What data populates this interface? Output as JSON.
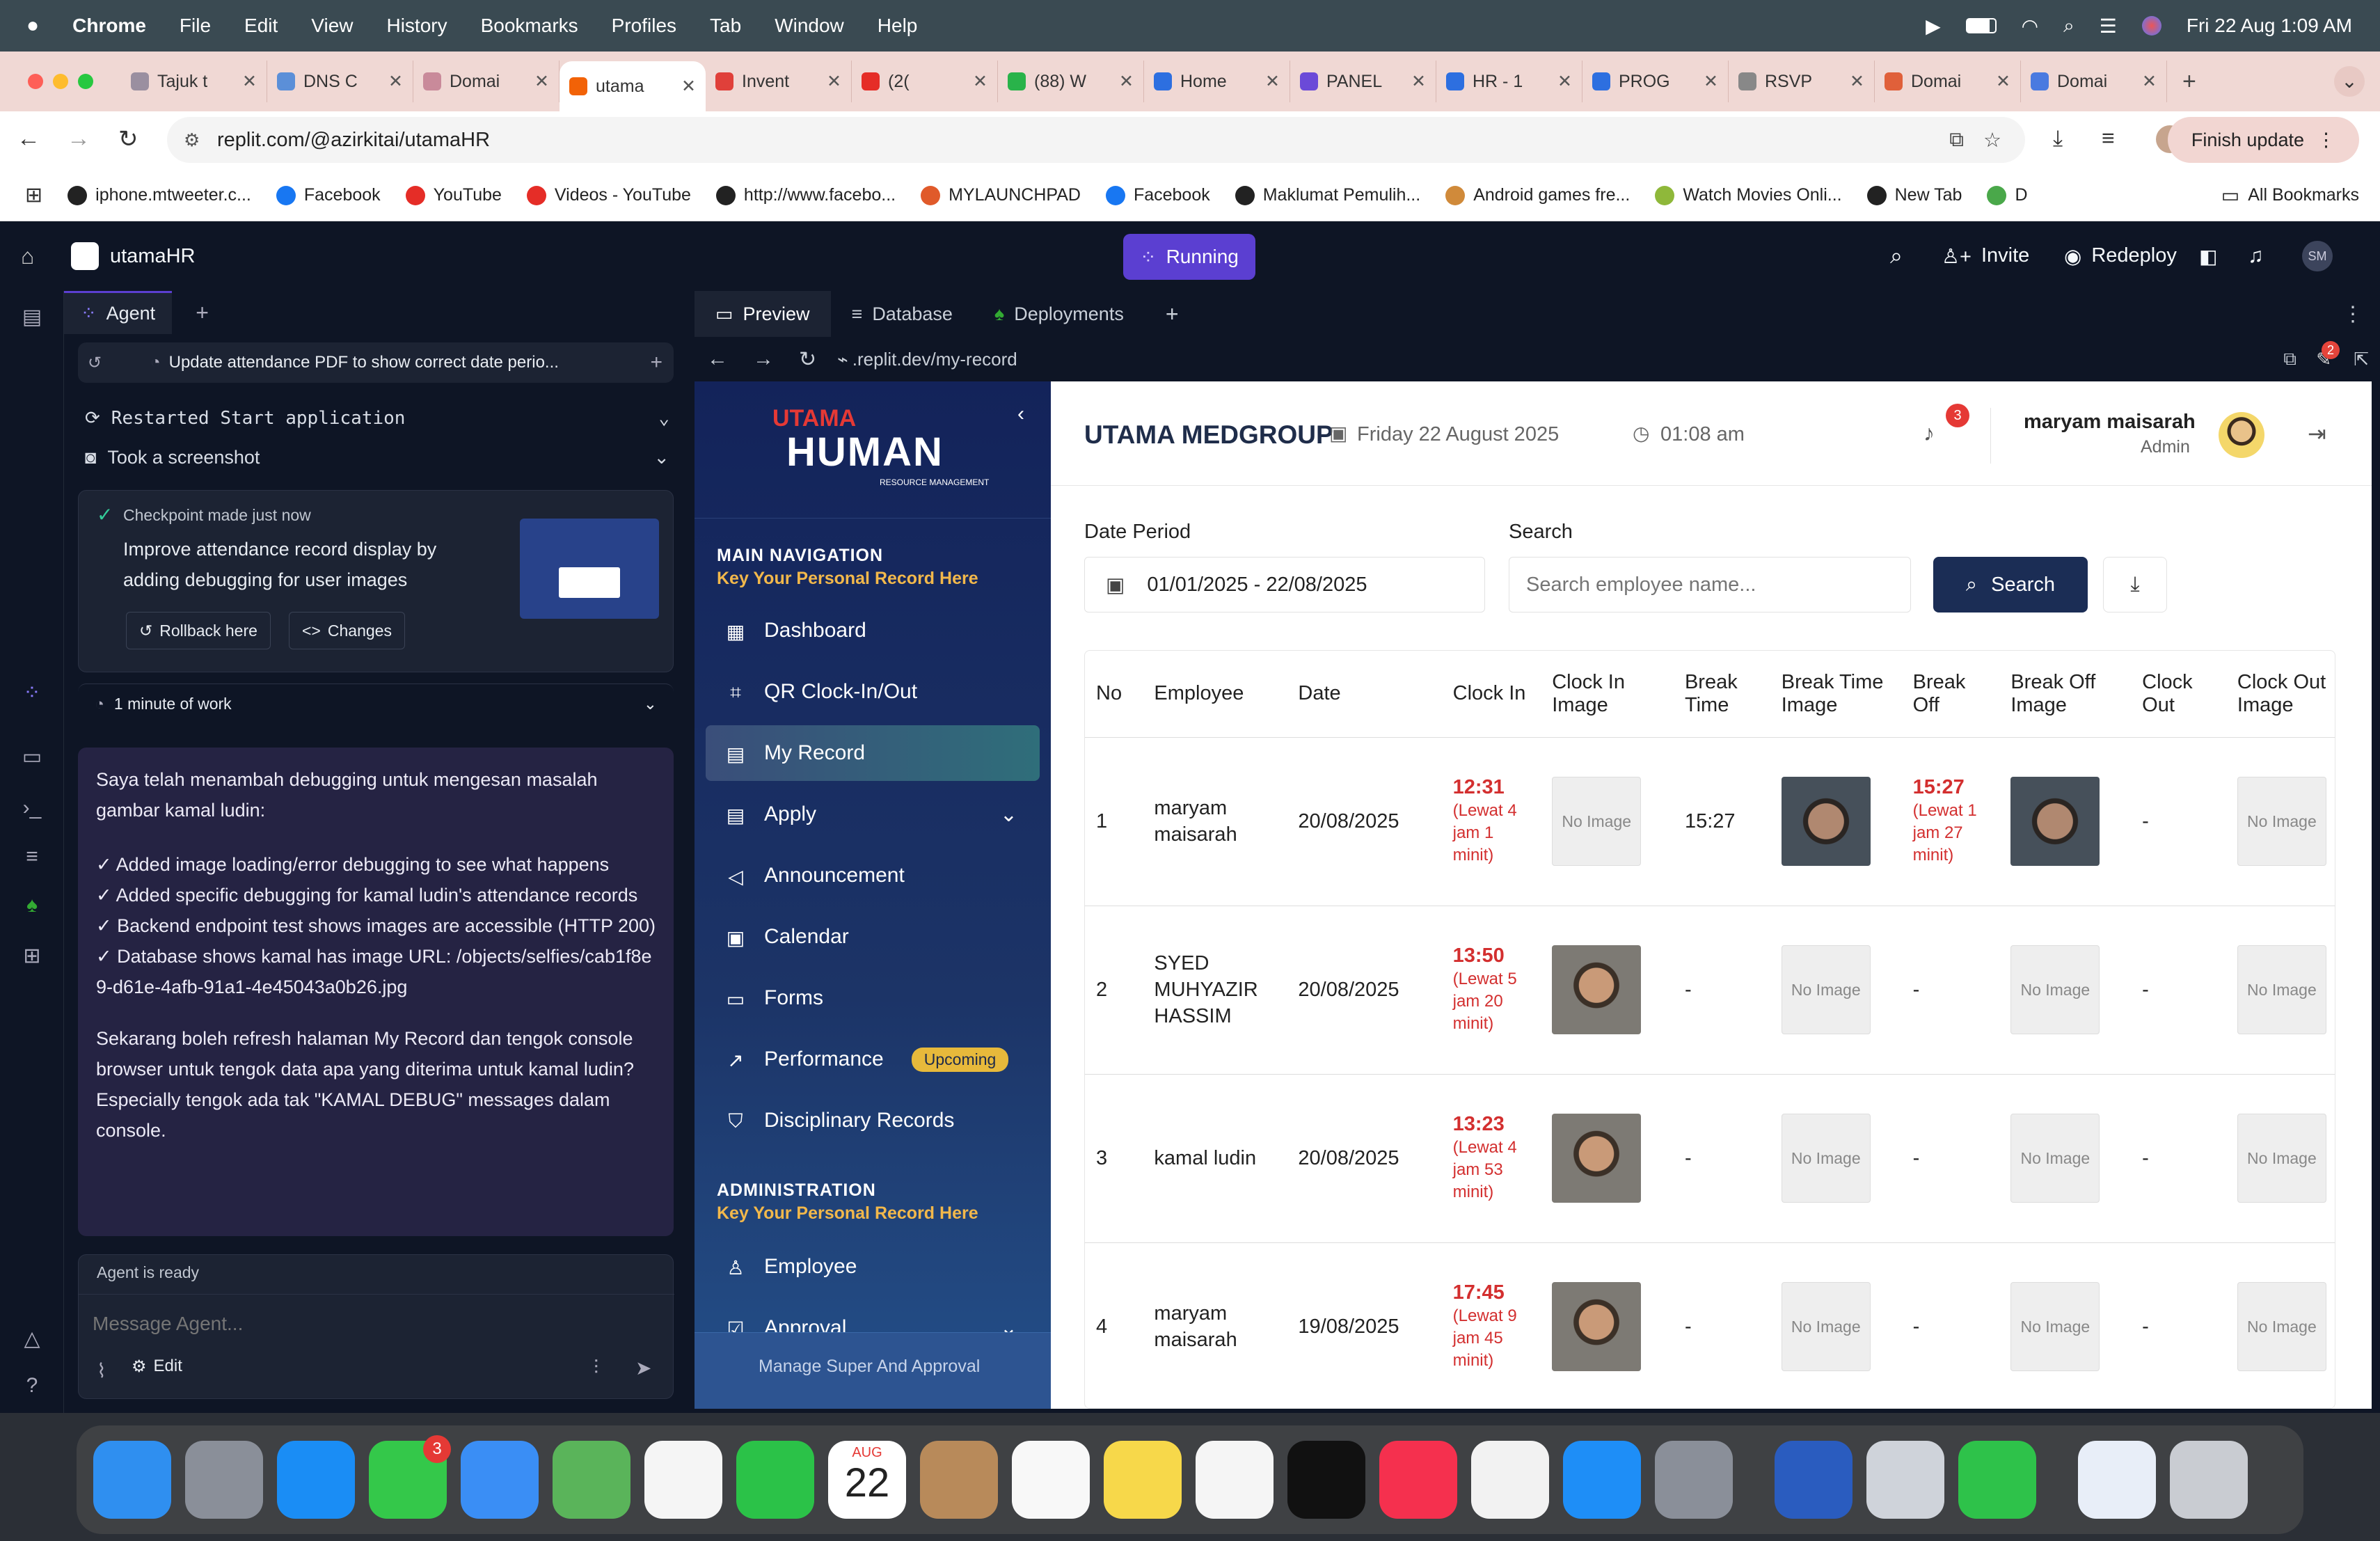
{
  "menubar": {
    "app": "Chrome",
    "items": [
      "File",
      "Edit",
      "View",
      "History",
      "Bookmarks",
      "Profiles",
      "Tab",
      "Window",
      "Help"
    ],
    "datetime": "Fri 22 Aug  1:09 AM"
  },
  "tabs": [
    {
      "label": "Tajuk t",
      "color": "#9a8fa0"
    },
    {
      "label": "DNS C",
      "color": "#5b8fd8"
    },
    {
      "label": "Domai",
      "color": "#c98a9a"
    },
    {
      "label": "utama",
      "color": "#f26207",
      "active": true
    },
    {
      "label": "Invent",
      "color": "#e0403a"
    },
    {
      "label": "(2(",
      "color": "#e52d27"
    },
    {
      "label": "(88) W",
      "color": "#29b34a"
    },
    {
      "label": "Home",
      "color": "#2d6fe0"
    },
    {
      "label": "PANEL",
      "color": "#6b4ad8"
    },
    {
      "label": "HR - 1",
      "color": "#2d6fe0"
    },
    {
      "label": "PROG",
      "color": "#2d6fe0"
    },
    {
      "label": "RSVP",
      "color": "#888888"
    },
    {
      "label": "Domai",
      "color": "#e0603a"
    },
    {
      "label": "Domai",
      "color": "#4a7ae0"
    }
  ],
  "browser": {
    "url": "replit.com/@azirkitai/utamaHR",
    "finish_update": "Finish update"
  },
  "bookmarks": [
    {
      "label": "iphone.mtweeter.c...",
      "color": "#222"
    },
    {
      "label": "Facebook",
      "color": "#1877f2"
    },
    {
      "label": "YouTube",
      "color": "#e52d27"
    },
    {
      "label": "Videos - YouTube",
      "color": "#e52d27"
    },
    {
      "label": "http://www.facebo...",
      "color": "#222"
    },
    {
      "label": "MYLAUNCHPAD",
      "color": "#e05a2a"
    },
    {
      "label": "Facebook",
      "color": "#1877f2"
    },
    {
      "label": "Maklumat Pemulih...",
      "color": "#222"
    },
    {
      "label": "Android games fre...",
      "color": "#d08a3a"
    },
    {
      "label": "Watch Movies Onli...",
      "color": "#8fb83a"
    },
    {
      "label": "New Tab",
      "color": "#222"
    },
    {
      "label": "D",
      "color": "#4aa84a"
    }
  ],
  "all_bookmarks": "All Bookmarks",
  "replit": {
    "project": "utamaHR",
    "status": "Running",
    "invite": "Invite",
    "redeploy": "Redeploy",
    "avatar": "SM",
    "agent_tab": "Agent",
    "agent_task": "Update attendance PDF to show correct date perio...",
    "events": [
      "Restarted Start application",
      "Took a screenshot"
    ],
    "checkpoint_label": "Checkpoint made just now",
    "checkpoint_text": "Improve attendance record display by adding debugging for user images",
    "rollback": "Rollback here",
    "changes": "Changes",
    "work_time": "1 minute of work",
    "message_intro": "Saya telah menambah debugging untuk mengesan masalah gambar kamal ludin:",
    "message_checks": [
      "✓ Added image loading/error debugging to see what happens",
      "✓ Added specific debugging for kamal ludin's attendance records",
      "✓ Backend endpoint test shows images are accessible (HTTP 200)",
      "✓ Database shows kamal has image URL: /objects/selfies/cab1f8e9-d61e-4afb-91a1-4e45043a0b26.jpg"
    ],
    "message_outro": "Sekarang boleh refresh halaman My Record dan tengok console browser untuk tengok data apa yang diterima untuk kamal ludin? Especially tengok ada tak \"KAMAL DEBUG\" messages dalam console.",
    "agent_status": "Agent is ready",
    "input_placeholder": "Message Agent...",
    "edit": "Edit",
    "preview_tabs": [
      "Preview",
      "Database",
      "Deployments"
    ],
    "preview_url": ".replit.dev/my-record",
    "notif_count": "2"
  },
  "app": {
    "logo_top": "UTAMA",
    "logo_main": "HUMAN",
    "logo_sub": "RESOURCE MANAGEMENT",
    "company": "UTAMA MEDGROUP",
    "date": "Friday 22 August 2025",
    "time": "01:08 am",
    "notifications": "3",
    "user_name": "maryam maisarah",
    "user_role": "Admin",
    "main_nav_title": "MAIN NAVIGATION",
    "main_nav_sub": "Key Your Personal Record Here",
    "nav": [
      {
        "label": "Dashboard",
        "icon": "dashboard-icon",
        "glyph": "▦"
      },
      {
        "label": "QR Clock-In/Out",
        "icon": "qr-icon",
        "glyph": "⌗"
      },
      {
        "label": "My Record",
        "icon": "document-icon",
        "glyph": "▤",
        "active": true
      },
      {
        "label": "Apply",
        "icon": "apply-icon",
        "glyph": "▤",
        "chevron": true
      },
      {
        "label": "Announcement",
        "icon": "megaphone-icon",
        "glyph": "◁"
      },
      {
        "label": "Calendar",
        "icon": "calendar-icon",
        "glyph": "▣"
      },
      {
        "label": "Forms",
        "icon": "forms-icon",
        "glyph": "▭"
      },
      {
        "label": "Performance",
        "icon": "trend-icon",
        "glyph": "↗",
        "badge": "Upcoming"
      },
      {
        "label": "Disciplinary Records",
        "icon": "shield-icon",
        "glyph": "⛉"
      }
    ],
    "admin_title": "ADMINISTRATION",
    "admin_sub": "Key Your Personal Record Here",
    "admin_nav": [
      {
        "label": "Employee",
        "icon": "users-icon",
        "glyph": "♙"
      },
      {
        "label": "Approval",
        "icon": "approval-icon",
        "glyph": "☑",
        "chevron": true
      }
    ],
    "sidebar_footer": "Manage Super And Approval",
    "date_period_label": "Date Period",
    "date_period_value": "01/01/2025 - 22/08/2025",
    "search_label": "Search",
    "search_placeholder": "Search employee name...",
    "search_button": "Search",
    "columns": [
      "No",
      "Employee",
      "Date",
      "Clock In",
      "Clock In Image",
      "Break Time",
      "Break Time Image",
      "Break Off",
      "Break Off Image",
      "Clock Out",
      "Clock Out Image"
    ],
    "no_image": "No Image",
    "rows": [
      {
        "no": "1",
        "employee": "maryam maisarah",
        "date": "20/08/2025",
        "clock_in": "12:31",
        "clock_in_late": "(Lewat 4 jam 1 minit)",
        "clock_in_img": false,
        "break_time": "15:27",
        "break_img": true,
        "break_off": "15:27",
        "break_off_late": "(Lewat 1 jam 27 minit)",
        "break_off_img": true,
        "clock_out": "-",
        "clock_out_img": false
      },
      {
        "no": "2",
        "employee": "SYED MUHYAZIR HASSIM",
        "date": "20/08/2025",
        "clock_in": "13:50",
        "clock_in_late": "(Lewat 5 jam 20 minit)",
        "clock_in_img": true,
        "break_time": "-",
        "break_img": false,
        "break_off": "-",
        "break_off_late": "",
        "break_off_img": false,
        "clock_out": "-",
        "clock_out_img": false
      },
      {
        "no": "3",
        "employee": "kamal ludin",
        "date": "20/08/2025",
        "clock_in": "13:23",
        "clock_in_late": "(Lewat 4 jam 53 minit)",
        "clock_in_img": true,
        "break_time": "-",
        "break_img": false,
        "break_off": "-",
        "break_off_late": "",
        "break_off_img": false,
        "clock_out": "-",
        "clock_out_img": false
      },
      {
        "no": "4",
        "employee": "maryam maisarah",
        "date": "19/08/2025",
        "clock_in": "17:45",
        "clock_in_late": "(Lewat 9 jam 45 minit)",
        "clock_in_img": true,
        "break_time": "-",
        "break_img": false,
        "break_off": "-",
        "break_off_late": "",
        "break_off_img": false,
        "clock_out": "-",
        "clock_out_img": false
      }
    ]
  },
  "dock": {
    "calendar_month": "AUG",
    "calendar_day": "22",
    "messages_badge": "3",
    "apps": [
      {
        "name": "finder-icon",
        "color": "#2f8ff0"
      },
      {
        "name": "launchpad-icon",
        "color": "#8a8f99"
      },
      {
        "name": "safari-icon",
        "color": "#1a8df5"
      },
      {
        "name": "messages-icon",
        "color": "#34c84a"
      },
      {
        "name": "mail-icon",
        "color": "#3a8ef5"
      },
      {
        "name": "maps-icon",
        "color": "#5ab45a"
      },
      {
        "name": "photos-icon",
        "color": "#f5f5f5"
      },
      {
        "name": "facetime-icon",
        "color": "#2bc248"
      },
      {
        "name": "calendar-icon",
        "color": "#ffffff"
      },
      {
        "name": "contacts-icon",
        "color": "#b88a5a"
      },
      {
        "name": "reminders-icon",
        "color": "#f8f8f8"
      },
      {
        "name": "notes-icon",
        "color": "#f7d84a"
      },
      {
        "name": "freeform-icon",
        "color": "#f5f5f5"
      },
      {
        "name": "appletv-icon",
        "color": "#111111"
      },
      {
        "name": "music-icon",
        "color": "#f5304e"
      },
      {
        "name": "chrome-icon",
        "color": "#f2f2f2"
      },
      {
        "name": "appstore-icon",
        "color": "#1e8ef7"
      },
      {
        "name": "settings-icon",
        "color": "#8a8f99"
      },
      {
        "name": "word-icon",
        "color": "#2a5cbf"
      },
      {
        "name": "iphone-mirroring-icon",
        "color": "#cfd3da"
      },
      {
        "name": "numbers-icon",
        "color": "#2ec24a"
      },
      {
        "name": "documents-stack-icon",
        "color": "#e8eef8"
      },
      {
        "name": "trash-icon",
        "color": "#c9ccd2"
      }
    ]
  }
}
